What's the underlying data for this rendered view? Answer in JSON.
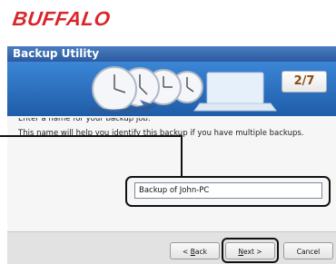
{
  "brand": {
    "logo_text": "BUFFALO",
    "accent": "#d9262b"
  },
  "window": {
    "title": "Backup Utility",
    "title_bar_color": "#2c5aa0"
  },
  "banner": {
    "step": "2/7",
    "icon": "clocks-and-laptop-illustration"
  },
  "content": {
    "prompt_line1": "Enter a name for your backup job.",
    "prompt_line2": "This name will help you identify this backup if you have multiple backups.",
    "backup_name_value": "Backup of John-PC"
  },
  "footer": {
    "back_label_pre": "< ",
    "back_label_key": "B",
    "back_label_post": "ack",
    "next_label_key": "N",
    "next_label_post": "ext >",
    "cancel_label": "Cancel"
  }
}
